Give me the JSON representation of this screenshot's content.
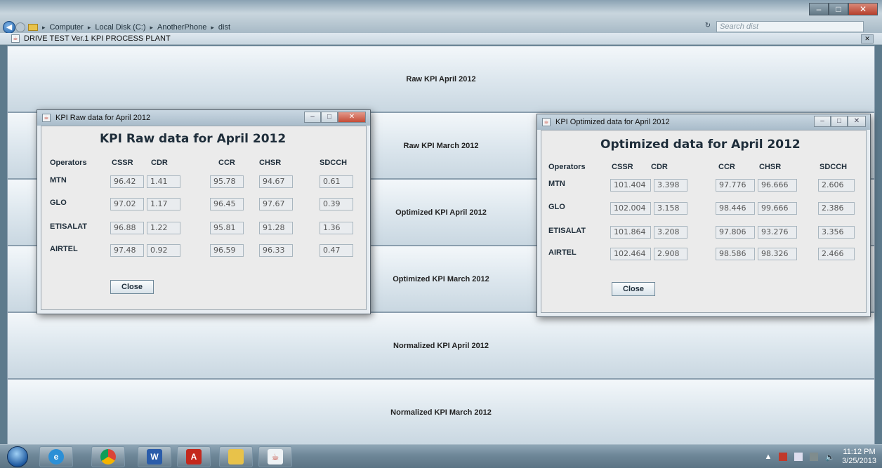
{
  "explorer": {
    "breadcrumb": [
      "Computer",
      "Local Disk (C:)",
      "AnotherPhone",
      "dist"
    ],
    "search_placeholder": "Search dist"
  },
  "app": {
    "title": "DRIVE TEST Ver.1 KPI PROCESS PLANT",
    "buttons": [
      "Raw KPI April 2012",
      "Raw KPI March 2012",
      "Optimized KPI April 2012",
      "Optimized KPI March 2012",
      "Normalized KPI April 2012",
      "Normalized KPI March 2012"
    ]
  },
  "raw_dialog": {
    "title": "KPI Raw data for April 2012",
    "heading": "KPI Raw data for April 2012",
    "columns": [
      "Operators",
      "CSSR",
      "CDR",
      "CCR",
      "CHSR",
      "SDCCH"
    ],
    "rows": [
      {
        "operator": "MTN",
        "values": [
          "96.42",
          "1.41",
          "95.78",
          "94.67",
          "0.61"
        ]
      },
      {
        "operator": "GLO",
        "values": [
          "97.02",
          "1.17",
          "96.45",
          "97.67",
          "0.39"
        ]
      },
      {
        "operator": "ETISALAT",
        "values": [
          "96.88",
          "1.22",
          "95.81",
          "91.28",
          "1.36"
        ]
      },
      {
        "operator": "AIRTEL",
        "values": [
          "97.48",
          "0.92",
          "96.59",
          "96.33",
          "0.47"
        ]
      }
    ],
    "close_label": "Close"
  },
  "opt_dialog": {
    "title": "KPI Optimized data for April 2012",
    "heading": "Optimized data for April 2012",
    "columns": [
      "Operators",
      "CSSR",
      "CDR",
      "CCR",
      "CHSR",
      "SDCCH"
    ],
    "rows": [
      {
        "operator": "MTN",
        "values": [
          "101.404",
          "3.398",
          "97.776",
          "96.666",
          "2.606"
        ]
      },
      {
        "operator": "GLO",
        "values": [
          "102.004",
          "3.158",
          "98.446",
          "99.666",
          "2.386"
        ]
      },
      {
        "operator": "ETISALAT",
        "values": [
          "101.864",
          "3.208",
          "97.806",
          "93.276",
          "3.356"
        ]
      },
      {
        "operator": "AIRTEL",
        "values": [
          "102.464",
          "2.908",
          "98.586",
          "98.326",
          "2.466"
        ]
      }
    ],
    "close_label": "Close"
  },
  "taskbar": {
    "clock_time": "11:12 PM",
    "clock_date": "3/25/2013"
  }
}
